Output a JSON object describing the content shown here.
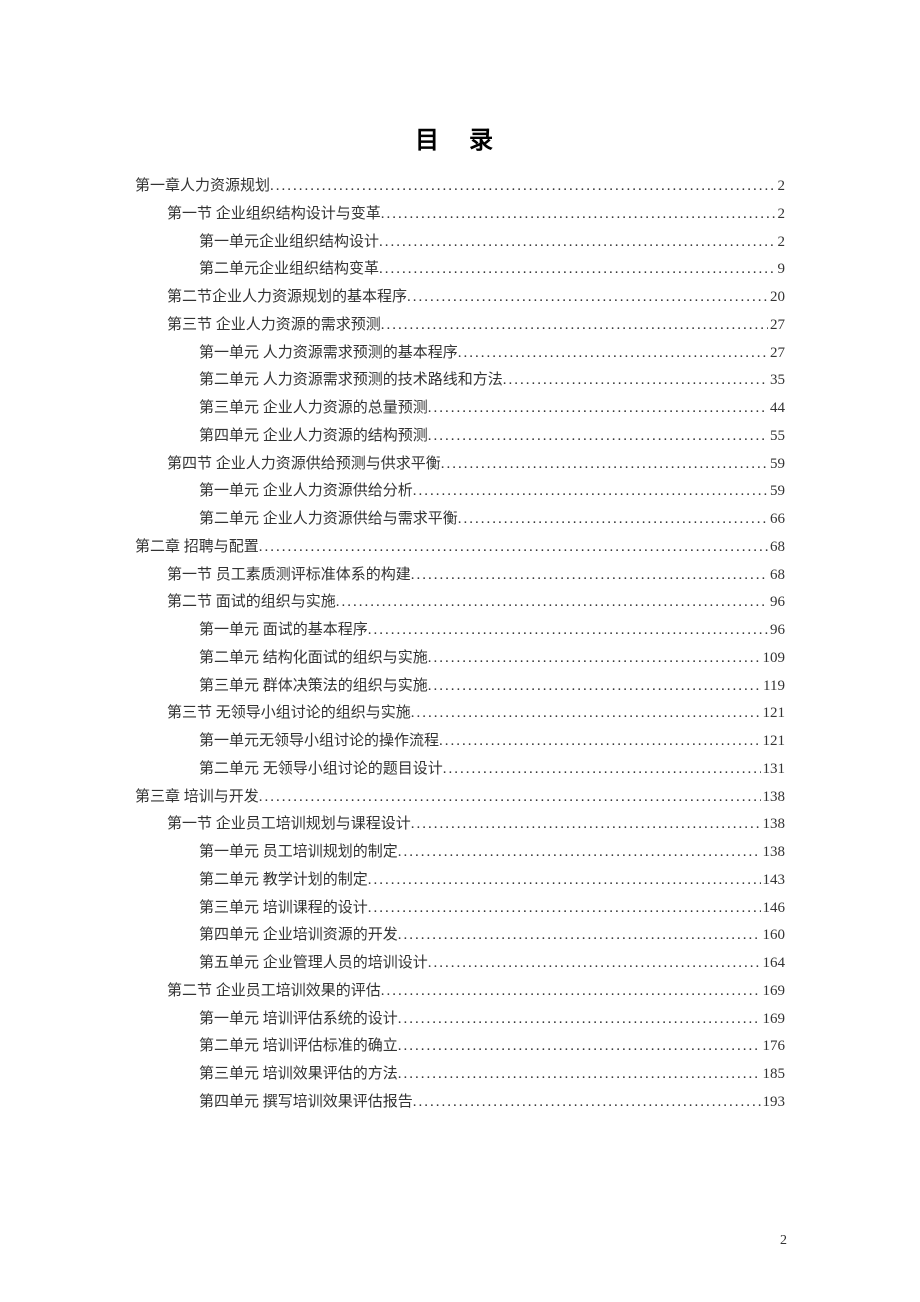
{
  "title": "目 录",
  "page_number": "2",
  "entries": [
    {
      "level": 1,
      "text": "第一章人力资源规划",
      "page": "2"
    },
    {
      "level": 2,
      "text": "第一节 企业组织结构设计与变革",
      "page": "2"
    },
    {
      "level": 3,
      "text": "第一单元企业组织结构设计",
      "page": "2"
    },
    {
      "level": 3,
      "text": "第二单元企业组织结构变革",
      "page": "9"
    },
    {
      "level": 2,
      "text": "第二节企业人力资源规划的基本程序",
      "page": "20"
    },
    {
      "level": 2,
      "text": "第三节 企业人力资源的需求预测",
      "page": "27"
    },
    {
      "level": 3,
      "text": "第一单元 人力资源需求预测的基本程序",
      "page": "27"
    },
    {
      "level": 3,
      "text": "第二单元 人力资源需求预测的技术路线和方法",
      "page": "35"
    },
    {
      "level": 3,
      "text": "第三单元 企业人力资源的总量预测",
      "page": "44"
    },
    {
      "level": 3,
      "text": "第四单元 企业人力资源的结构预测",
      "page": "55"
    },
    {
      "level": 2,
      "text": "第四节 企业人力资源供给预测与供求平衡",
      "page": "59"
    },
    {
      "level": 3,
      "text": "第一单元 企业人力资源供给分析",
      "page": "59"
    },
    {
      "level": 3,
      "text": "第二单元 企业人力资源供给与需求平衡",
      "page": "66"
    },
    {
      "level": 1,
      "text": "第二章 招聘与配置",
      "page": "68"
    },
    {
      "level": 2,
      "text": "第一节 员工素质测评标准体系的构建",
      "page": "68"
    },
    {
      "level": 2,
      "text": "第二节 面试的组织与实施",
      "page": "96"
    },
    {
      "level": 3,
      "text": "第一单元 面试的基本程序",
      "page": "96"
    },
    {
      "level": 3,
      "text": "第二单元 结构化面试的组织与实施",
      "page": "109"
    },
    {
      "level": 3,
      "text": "第三单元 群体决策法的组织与实施",
      "page": "119"
    },
    {
      "level": 2,
      "text": "第三节 无领导小组讨论的组织与实施",
      "page": "121"
    },
    {
      "level": 3,
      "text": "第一单元无领导小组讨论的操作流程",
      "page": "121"
    },
    {
      "level": 3,
      "text": "第二单元 无领导小组讨论的题目设计",
      "page": "131"
    },
    {
      "level": 1,
      "text": "第三章 培训与开发",
      "page": "138"
    },
    {
      "level": 2,
      "text": "第一节 企业员工培训规划与课程设计",
      "page": "138"
    },
    {
      "level": 3,
      "text": "第一单元 员工培训规划的制定",
      "page": "138"
    },
    {
      "level": 3,
      "text": "第二单元 教学计划的制定",
      "page": "143"
    },
    {
      "level": 3,
      "text": "第三单元 培训课程的设计",
      "page": "146"
    },
    {
      "level": 3,
      "text": "第四单元 企业培训资源的开发",
      "page": "160"
    },
    {
      "level": 3,
      "text": "第五单元 企业管理人员的培训设计",
      "page": "164"
    },
    {
      "level": 2,
      "text": "第二节 企业员工培训效果的评估",
      "page": "169"
    },
    {
      "level": 3,
      "text": "第一单元 培训评估系统的设计",
      "page": "169"
    },
    {
      "level": 3,
      "text": "第二单元 培训评估标准的确立",
      "page": "176"
    },
    {
      "level": 3,
      "text": "第三单元 培训效果评估的方法",
      "page": "185"
    },
    {
      "level": 3,
      "text": "第四单元 撰写培训效果评估报告",
      "page": "193"
    }
  ]
}
